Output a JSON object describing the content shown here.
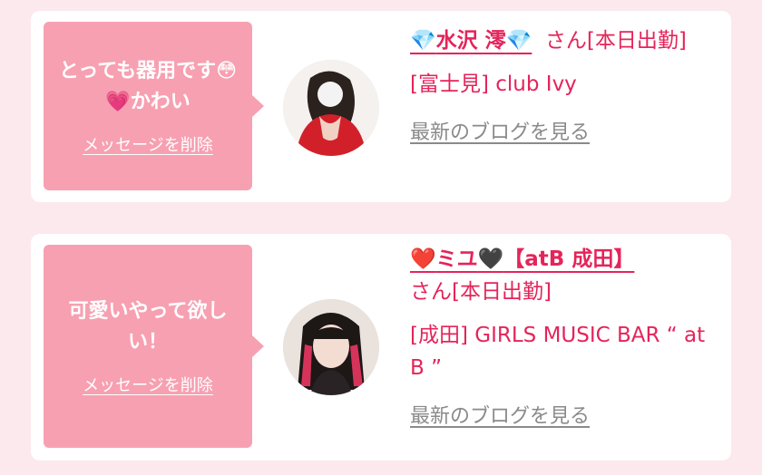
{
  "cards": [
    {
      "message": "とっても器用です😳💗かわい",
      "delete_label": "メッセージを削除",
      "name": "水沢 澪",
      "name_prefix_icon": "💎",
      "name_suffix_icon": "💎",
      "name_suffix_text": "",
      "honorific_status": "さん[本日出勤]",
      "shop": "[富士見] club Ivy",
      "blog_label": "最新のブログを見る"
    },
    {
      "message": "可愛いやって欲しい！",
      "delete_label": "メッセージを削除",
      "name": "ミユ",
      "name_prefix_icon": "❤️",
      "name_suffix_icon": "🖤",
      "name_suffix_text": "【atB 成田】",
      "honorific_status": "さん[本日出勤]",
      "shop": "[成田] GIRLS MUSIC BAR “ at B ”",
      "blog_label": "最新のブログを見る"
    }
  ],
  "colors": {
    "page_background": "#fbe9ee",
    "card_background": "#ffffff",
    "bubble_background": "#f7a0b1",
    "accent_text": "#e5245a",
    "blog_link": "#8a8a8a"
  }
}
